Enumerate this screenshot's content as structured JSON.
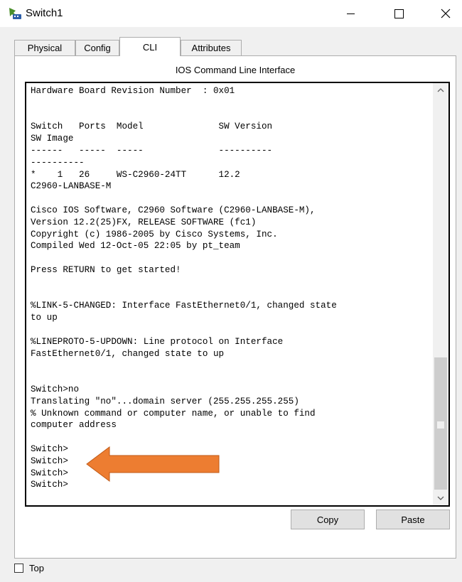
{
  "window": {
    "title": "Switch1",
    "app_icon": "packet-tracer-switch-icon"
  },
  "tabs": [
    {
      "label": "Physical",
      "active": false
    },
    {
      "label": "Config",
      "active": false
    },
    {
      "label": "CLI",
      "active": true
    },
    {
      "label": "Attributes",
      "active": false
    }
  ],
  "cli": {
    "heading": "IOS Command Line Interface",
    "lines": [
      "Hardware Board Revision Number  : 0x01",
      "",
      "",
      "Switch   Ports  Model              SW Version",
      "SW Image",
      "------   -----  -----              ----------",
      "----------",
      "*    1   26     WS-C2960-24TT      12.2",
      "C2960-LANBASE-M",
      "",
      "Cisco IOS Software, C2960 Software (C2960-LANBASE-M),",
      "Version 12.2(25)FX, RELEASE SOFTWARE (fc1)",
      "Copyright (c) 1986-2005 by Cisco Systems, Inc.",
      "Compiled Wed 12-Oct-05 22:05 by pt_team",
      "",
      "Press RETURN to get started!",
      "",
      "",
      "%LINK-5-CHANGED: Interface FastEthernet0/1, changed state",
      "to up",
      "",
      "%LINEPROTO-5-UPDOWN: Line protocol on Interface",
      "FastEthernet0/1, changed state to up",
      "",
      "",
      "Switch>no",
      "Translating \"no\"...domain server (255.255.255.255)",
      "% Unknown command or computer name, or unable to find",
      "computer address",
      "",
      "Switch>",
      "Switch>",
      "Switch>",
      "Switch>"
    ]
  },
  "buttons": {
    "copy": "Copy",
    "paste": "Paste"
  },
  "footer": {
    "top_label": "Top",
    "top_checked": false
  },
  "annotation": {
    "arrow_color": "#ed7d31"
  }
}
